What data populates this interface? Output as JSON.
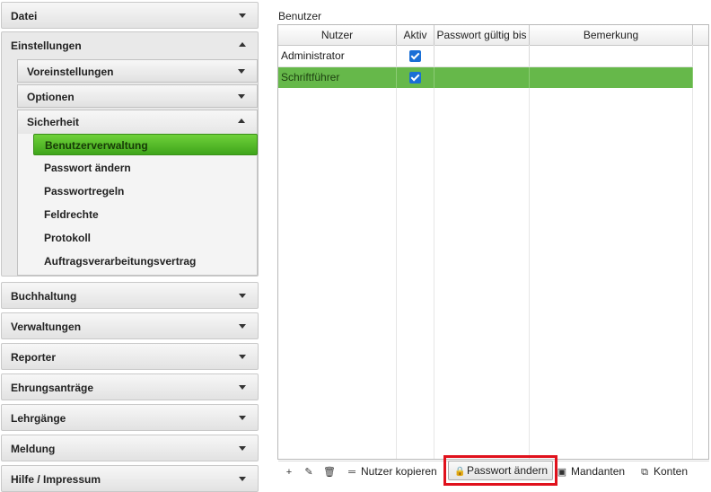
{
  "sidebar": {
    "datei": "Datei",
    "einstellungen": "Einstellungen",
    "voreinstellungen": "Voreinstellungen",
    "optionen": "Optionen",
    "sicherheit": "Sicherheit",
    "sicherheit_items": [
      "Benutzerverwaltung",
      "Passwort ändern",
      "Passwortregeln",
      "Feldrechte",
      "Protokoll",
      "Auftragsverarbeitungsvertrag"
    ],
    "sections": [
      "Buchhaltung",
      "Verwaltungen",
      "Reporter",
      "Ehrungsanträge",
      "Lehrgänge",
      "Meldung",
      "Hilfe / Impressum"
    ]
  },
  "main": {
    "title": "Benutzer",
    "columns": [
      "Nutzer",
      "Aktiv",
      "Passwort gültig bis",
      "Bemerkung"
    ],
    "rows": [
      {
        "nutzer": "Administrator",
        "aktiv": true,
        "passwort_gueltig_bis": "",
        "bemerkung": ""
      },
      {
        "nutzer": "Schriftführer",
        "aktiv": true,
        "passwort_gueltig_bis": "",
        "bemerkung": "",
        "selected": true
      }
    ]
  },
  "toolbar": {
    "add_icon": "plus-icon",
    "edit_icon": "pencil-icon",
    "delete_icon": "trash-icon",
    "copy_label": "Nutzer kopieren",
    "password_label": "Passwort ändern",
    "mandanten_label": "Mandanten",
    "konten_label": "Konten"
  },
  "colors": {
    "active_nav": "#4cb526",
    "selected_row": "#66b84a",
    "highlight_box": "#e0111c",
    "checkbox": "#1a6fd6"
  }
}
